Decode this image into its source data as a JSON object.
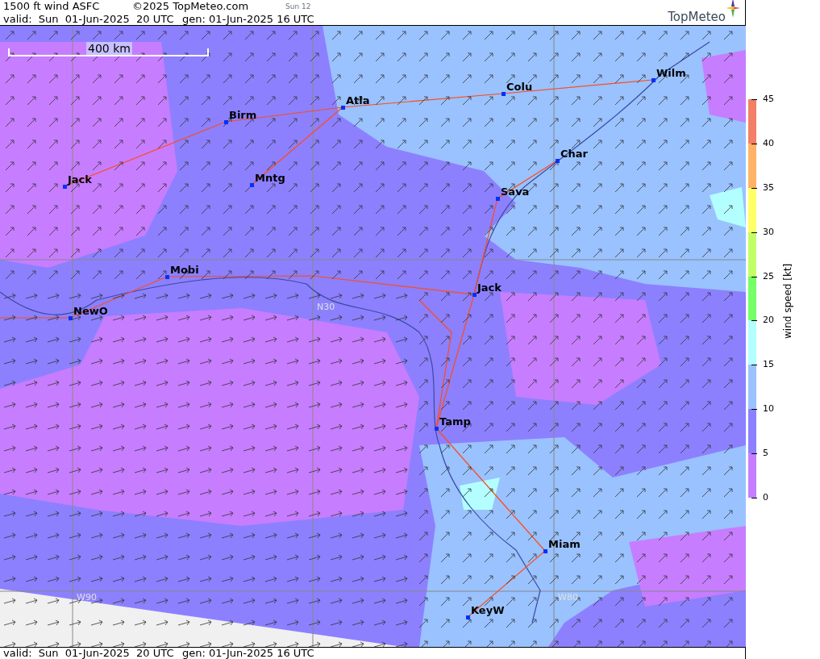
{
  "header": {
    "title": "1500 ft wind ASFC",
    "copyright": "©2025 TopMeteo.com",
    "run": "Sun 12",
    "valid": "valid:  Sun  01-Jun-2025  20 UTC",
    "generated": "gen: 01-Jun-2025 16 UTC",
    "logo": "TopMeteo"
  },
  "map": {
    "scale": "400 km",
    "grid_labels": [
      "N30",
      "W90",
      "W80"
    ],
    "cities": [
      {
        "name": "Wilm"
      },
      {
        "name": "Colu"
      },
      {
        "name": "Atla"
      },
      {
        "name": "Birm"
      },
      {
        "name": "Char"
      },
      {
        "name": "Jack"
      },
      {
        "name": "Mntg"
      },
      {
        "name": "Sava"
      },
      {
        "name": "Mobi"
      },
      {
        "name": "Jack"
      },
      {
        "name": "NewO"
      },
      {
        "name": "Tamp"
      },
      {
        "name": "Miam"
      },
      {
        "name": "KeyW"
      }
    ]
  },
  "colorbar": {
    "title": "wind speed [kt]",
    "bands": [
      {
        "color": "#f27f66"
      },
      {
        "color": "#ffb366"
      },
      {
        "color": "#ffff66"
      },
      {
        "color": "#c2ff66"
      },
      {
        "color": "#73ff66"
      },
      {
        "color": "#b3ffff"
      },
      {
        "color": "#99c2ff"
      },
      {
        "color": "#8c80ff"
      },
      {
        "color": "#c77dff"
      }
    ],
    "ticks": [
      "45",
      "40",
      "35",
      "30",
      "25",
      "20",
      "15",
      "10",
      "5",
      "0"
    ]
  },
  "footer": {
    "valid": "valid:  Sun  01-Jun-2025  20 UTC",
    "generated": "gen: 01-Jun-2025 16 UTC"
  }
}
